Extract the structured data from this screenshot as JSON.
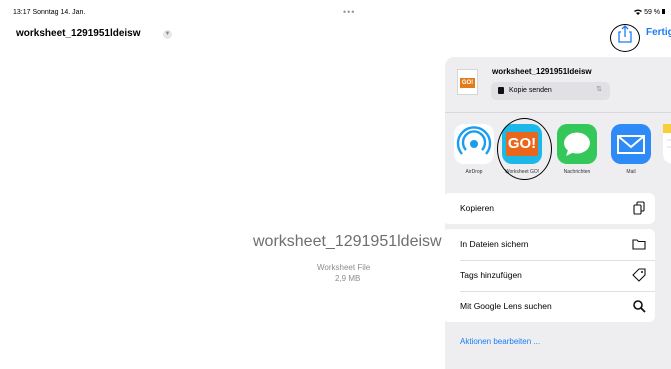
{
  "status_bar": {
    "time": "13:17  Sonntag 14. Jan.",
    "dots": "•••",
    "battery": "59 %"
  },
  "document": {
    "title": "worksheet_1291951ldeisw",
    "done_label": "Fertig"
  },
  "preview": {
    "filename": "worksheet_1291951ldeisw",
    "kind": "Worksheet File",
    "size": "2,9 MB"
  },
  "share_sheet": {
    "file_title": "worksheet_1291951ldeisw",
    "thumb_logo": "GO!",
    "send_option": "Kopie senden",
    "apps": [
      {
        "label": "AirDrop",
        "icon": "airdrop-icon"
      },
      {
        "label": "Worksheet GO!",
        "icon": "worksheet-go-icon",
        "badge": "GO!"
      },
      {
        "label": "Nachrichten",
        "icon": "messages-icon"
      },
      {
        "label": "Mail",
        "icon": "mail-icon"
      },
      {
        "label": "",
        "icon": "notes-icon"
      }
    ],
    "actions_group1": [
      {
        "label": "Kopieren",
        "icon": "copy-icon"
      }
    ],
    "actions_group2": [
      {
        "label": "In Dateien sichern",
        "icon": "folder-icon"
      },
      {
        "label": "Tags hinzufügen",
        "icon": "tag-icon"
      },
      {
        "label": "Mit Google Lens suchen",
        "icon": "search-icon"
      }
    ],
    "edit_actions": "Aktionen bearbeiten ..."
  },
  "colors": {
    "accent": "#1a7cf5",
    "sheet_bg": "#eeeef1"
  }
}
